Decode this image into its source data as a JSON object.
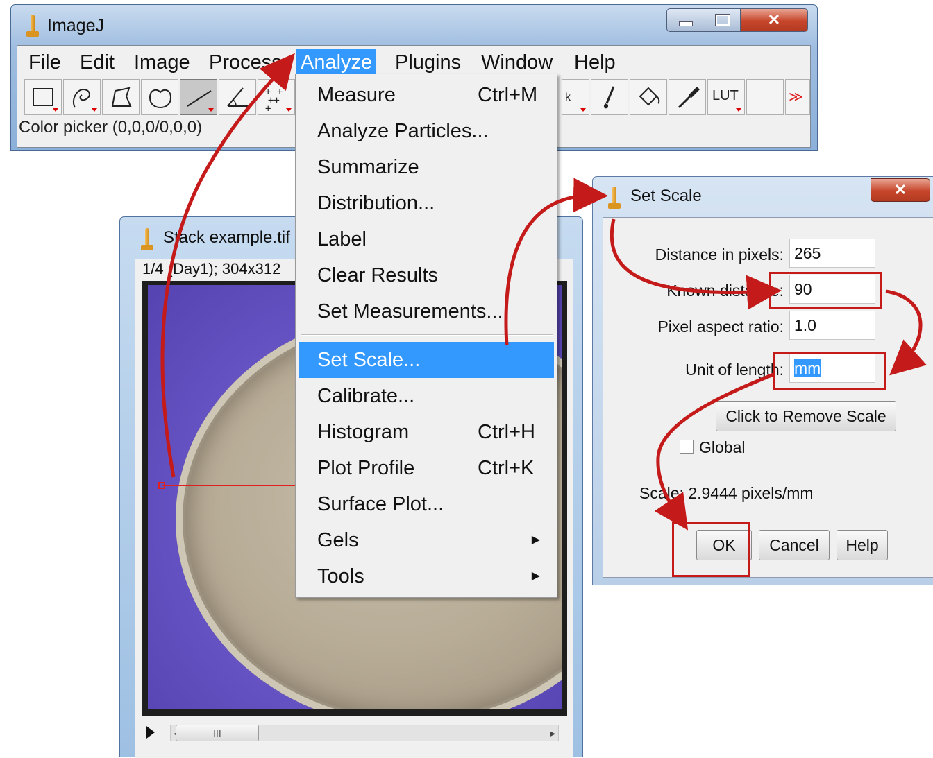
{
  "main_window": {
    "title": "ImageJ",
    "menu": [
      "File",
      "Edit",
      "Image",
      "Process",
      "Analyze",
      "Plugins",
      "Window",
      "Help"
    ],
    "active_menu": "Analyze",
    "toolbar": {
      "tools": [
        "rectangle-tool",
        "freehand-tool",
        "polygon-tool",
        "oval-tool",
        "line-tool",
        "angle-tool",
        "multi-point-tool",
        "wand-tool",
        "brush-tool",
        "flood-fill-tool",
        "color-picker-tool",
        "lut-menu"
      ],
      "selected_tool": "line-tool",
      "lut_label": "LUT",
      "more_label": "≫"
    },
    "status": "Color picker (0,0,0/0,0,0)"
  },
  "stack_window": {
    "title": "Stack example.tif",
    "info": "1/4 (Day1); 304x312",
    "scroll_thumb": "III"
  },
  "analyze_menu": {
    "items": [
      {
        "label": "Measure",
        "shortcut": "Ctrl+M"
      },
      {
        "label": "Analyze Particles...",
        "shortcut": ""
      },
      {
        "label": "Summarize",
        "shortcut": ""
      },
      {
        "label": "Distribution...",
        "shortcut": ""
      },
      {
        "label": "Label",
        "shortcut": ""
      },
      {
        "label": "Clear Results",
        "shortcut": ""
      },
      {
        "label": "Set Measurements...",
        "shortcut": ""
      },
      {
        "label": "Set Scale...",
        "shortcut": ""
      },
      {
        "label": "Calibrate...",
        "shortcut": ""
      },
      {
        "label": "Histogram",
        "shortcut": "Ctrl+H"
      },
      {
        "label": "Plot Profile",
        "shortcut": "Ctrl+K"
      },
      {
        "label": "Surface Plot...",
        "shortcut": ""
      },
      {
        "label": "Gels",
        "shortcut": "",
        "submenu": true
      },
      {
        "label": "Tools",
        "shortcut": "",
        "submenu": true
      }
    ],
    "selected": "Set Scale..."
  },
  "set_scale_dialog": {
    "title": "Set Scale",
    "fields": {
      "distance_in_pixels": {
        "label": "Distance in pixels:",
        "value": "265"
      },
      "known_distance": {
        "label": "Known distance:",
        "value": "90"
      },
      "pixel_aspect_ratio": {
        "label": "Pixel aspect ratio:",
        "value": "1.0"
      },
      "unit_of_length": {
        "label": "Unit of length:",
        "value": "mm"
      }
    },
    "remove_scale_label": "Click to Remove Scale",
    "global_label": "Global",
    "global_checked": false,
    "scale_text": "Scale: 2.9444 pixels/mm",
    "ok_label": "OK",
    "cancel_label": "Cancel",
    "help_label": "Help"
  },
  "colors": {
    "menu_highlight": "#3399ff",
    "annotation_red": "#c41a1a"
  }
}
